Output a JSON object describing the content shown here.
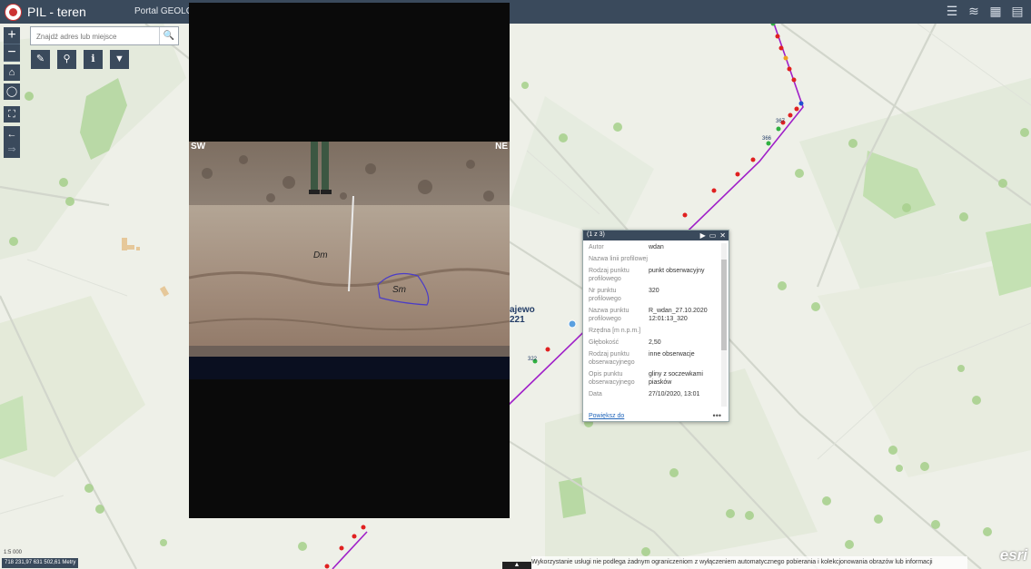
{
  "header": {
    "title": "PIL - teren",
    "subtitle": "Portal GEOLOG",
    "icons": [
      "list-icon",
      "layers-icon",
      "basemap-icon",
      "bookmark-icon"
    ]
  },
  "search": {
    "placeholder": "Znajdź adres lub miejsce"
  },
  "zoom": {
    "in_label": "+",
    "out_label": "−"
  },
  "photo": {
    "left_label": "SW",
    "right_label": "NE",
    "unit_dm": "Dm",
    "unit_sm": "Sm"
  },
  "map_labels": {
    "place": "ajewo",
    "place_number": "221",
    "point_367": "367",
    "point_366": "366",
    "point_322": "322"
  },
  "popup": {
    "count": "(1 z 3)",
    "fields": [
      {
        "key": "Autor",
        "value": "wdan"
      },
      {
        "key": "Nazwa linii profilowej",
        "value": ""
      },
      {
        "key": "Rodzaj punktu profilowego",
        "value": "punkt obserwacyjny"
      },
      {
        "key": "Nr punktu profilowego",
        "value": "320"
      },
      {
        "key": "Nazwa punktu profilowego",
        "value": "R_wdan_27.10.2020 12:01:13_320"
      },
      {
        "key": "Rzędna [m n.p.m.]",
        "value": ""
      },
      {
        "key": "Głębokość",
        "value": "2,50"
      },
      {
        "key": "Rodzaj punktu obserwacyjnego",
        "value": "inne obserwacje"
      },
      {
        "key": "Opis punktu obserwacyjnego",
        "value": "gliny z soczewkami piasków"
      },
      {
        "key": "Data",
        "value": "27/10/2020, 13:01"
      }
    ],
    "zoom_link": "Powiększ do",
    "more": "•••"
  },
  "scale": "1:5 000",
  "coords": "718 231,97 631 502,61 Metry",
  "attribution": "Wykorzystanie usługi nie podlega żadnym ograniczeniom z wyłączeniem automatycznego pobierania i kolekcjonowania obrazów lub informacji",
  "esri": "esri",
  "colors": {
    "header": "#3a4a5c",
    "profile_line": "#a020c8",
    "point_red": "#e02020",
    "point_green": "#30b040"
  }
}
